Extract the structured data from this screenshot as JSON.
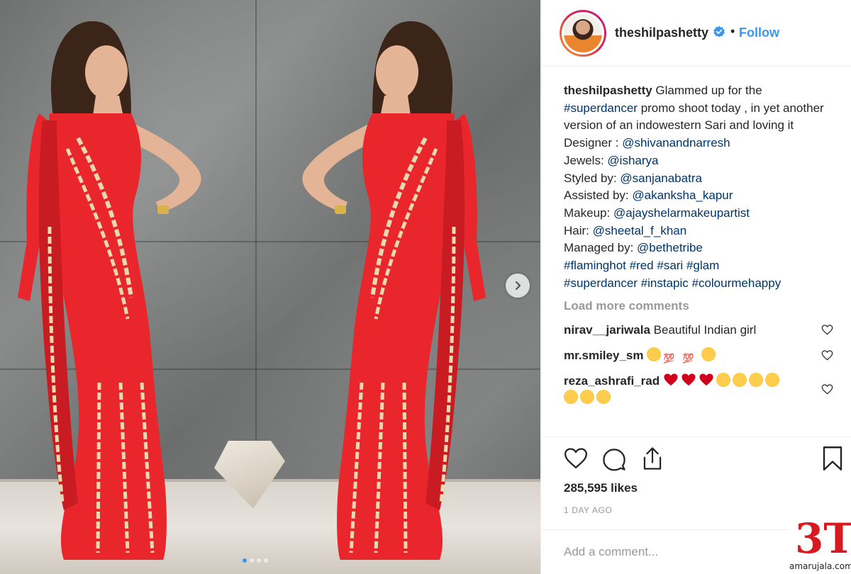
{
  "post": {
    "image_alt": "Woman in red one-shoulder embellished sari gown posing against marble wall",
    "carousel_count": 4,
    "carousel_active": 1
  },
  "header": {
    "username": "theshilpashetty",
    "bullet": "•",
    "follow_label": "Follow"
  },
  "caption": {
    "username": "theshilpashetty",
    "text_1": " Glammed up for the ",
    "hashtag_1": "#superdancer",
    "text_2": " promo shoot today , in yet another version of an indowestern Sari and loving it",
    "designer_label": "Designer : ",
    "designer": "@shivanandnarresh",
    "jewels_label": "Jewels: ",
    "jewels": "@isharya",
    "styled_label": "Styled by: ",
    "styled": "@sanjanabatra",
    "assisted_label": "Assisted by: ",
    "assisted": "@akanksha_kapur",
    "makeup_label": "Makeup: ",
    "makeup": "@ajayshelarmakeupartist",
    "hair_label": "Hair: ",
    "hair": "@sheetal_f_khan",
    "managed_label": "Managed by: ",
    "managed": "@bethetribe",
    "tags_line_1": "#flaminghot #red #sari #glam",
    "tags_line_2": "#superdancer #instapic #colourmehappy"
  },
  "load_more_label": "Load more comments",
  "comments": [
    {
      "username": "nirav__jariwala",
      "text": "Beautiful Indian girl"
    },
    {
      "username": "mr.smiley_sm",
      "text": ""
    },
    {
      "username": "reza_ashrafi_rad",
      "text": ""
    },
    {
      "username": "",
      "text": ""
    }
  ],
  "actions": {
    "likes": "285,595 likes",
    "timestamp": "1 DAY AGO",
    "comment_placeholder": "Add a comment..."
  },
  "watermark": {
    "logo": "3T",
    "site": "amarujala.com"
  },
  "colors": {
    "link": "#003569",
    "follow": "#3897f0",
    "muted": "#999999",
    "dress_red": "#e8262c",
    "watermark_red": "#d71920"
  },
  "icons": [
    "verified-badge-icon",
    "chevron-right-icon",
    "heart-icon",
    "comment-icon",
    "share-icon",
    "bookmark-icon",
    "heart-small-icon"
  ]
}
